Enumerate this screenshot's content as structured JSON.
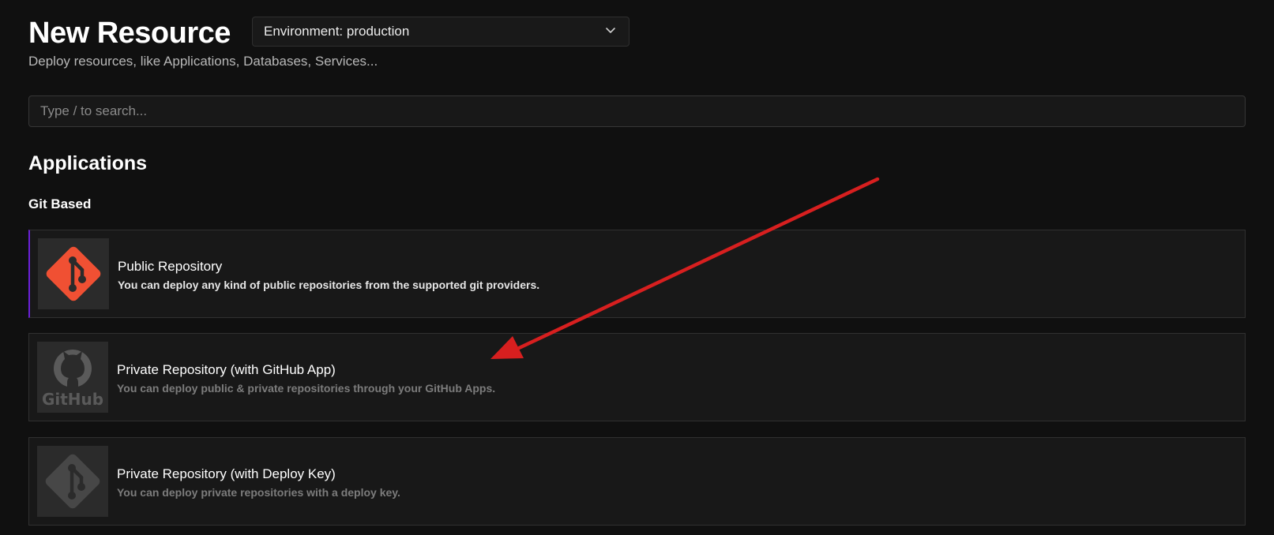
{
  "header": {
    "title": "New Resource",
    "subtitle": "Deploy resources, like Applications, Databases, Services...",
    "environment_select": {
      "value": "Environment: production",
      "icon": "chevron-down-icon"
    }
  },
  "search": {
    "placeholder": "Type / to search..."
  },
  "section": {
    "title": "Applications",
    "subsection": "Git Based",
    "cards": [
      {
        "name": "Public Repository",
        "description": "You can deploy any kind of public repositories from the supported git providers.",
        "icon": "git-icon",
        "icon_color": "#f05033"
      },
      {
        "name": "Private Repository (with GitHub App)",
        "description": "You can deploy public & private repositories through your GitHub Apps.",
        "icon": "github-icon",
        "icon_text": "GitHub",
        "icon_color": "#5a5a5a"
      },
      {
        "name": "Private Repository (with Deploy Key)",
        "description": "You can deploy private repositories with a deploy key.",
        "icon": "git-icon",
        "icon_color": "#4a4a4a"
      }
    ]
  },
  "annotation": {
    "arrow_color": "#d71f1f"
  }
}
